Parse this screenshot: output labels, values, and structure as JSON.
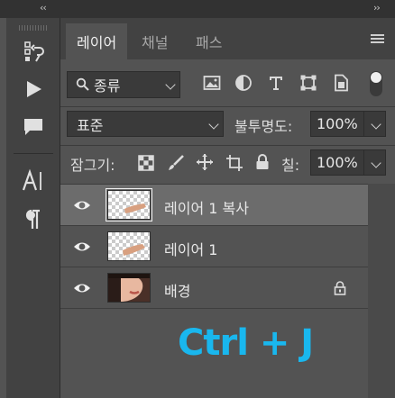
{
  "collapse_left": "‹‹",
  "collapse_right": "››",
  "toolbar": {
    "tools": [
      "history-brush-icon",
      "play-icon",
      "comment-icon",
      "character-icon",
      "paragraph-icon"
    ]
  },
  "tabs": [
    {
      "label": "레이어",
      "active": true
    },
    {
      "label": "채널",
      "active": false
    },
    {
      "label": "패스",
      "active": false
    }
  ],
  "filter": {
    "type_value": "종류",
    "filter_icons": [
      "image-filter-icon",
      "adjustment-filter-icon",
      "type-filter-icon",
      "shape-filter-icon",
      "smart-object-filter-icon"
    ]
  },
  "blend": {
    "mode": "표준",
    "opacity_label": "불투명도:",
    "opacity_value": "100%"
  },
  "lock": {
    "label": "잠그기:",
    "fill_label": "칠:",
    "fill_value": "100%"
  },
  "layers": [
    {
      "name": "레이어 1 복사",
      "selected": true,
      "locked": false,
      "thumb": "transparent-arm"
    },
    {
      "name": "레이어 1",
      "selected": false,
      "locked": false,
      "thumb": "transparent-arm"
    },
    {
      "name": "배경",
      "selected": false,
      "locked": true,
      "thumb": "photo"
    }
  ],
  "overlay_text": "Ctrl + J",
  "colors": {
    "accent": "#19b7ee",
    "panel": "#535353",
    "selected_layer": "#6c6c6c"
  }
}
